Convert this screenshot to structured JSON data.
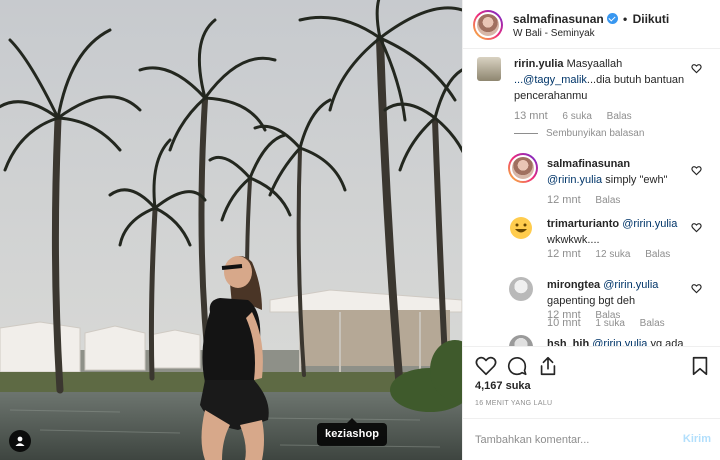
{
  "photo": {
    "tag_label": "keziashop",
    "user_tag_icon": "user-tag-icon"
  },
  "header": {
    "username": "salmafinasunan",
    "separator": "•",
    "follow_status": "Diikuti",
    "location": "W Bali - Seminyak",
    "verified_icon": "verified-badge-icon"
  },
  "comments": [
    {
      "user": "ririn.yulia",
      "text_before": "Masyaallah",
      "mention": "...@tagy_malik",
      "text_after": "...dia butuh bantuan pencerahanmu",
      "time": "13 mnt",
      "likes": "6 suka",
      "reply_label": "Balas"
    }
  ],
  "hide_replies_label": "Sembunyikan balasan",
  "replies": [
    {
      "user": "salmafinasunan",
      "mention": "@ririn.yulia",
      "text": "simply \"ewh\"",
      "time": "12 mnt",
      "likes": "",
      "reply_label": "Balas"
    },
    {
      "user": "trimarturianto",
      "mention": "@ririn.yulia",
      "text": "wkwkwk....",
      "time": "12 mnt",
      "likes": "12 suka",
      "reply_label": "Balas"
    },
    {
      "user": "mirongtea",
      "mention": "@ririn.yulia",
      "text": "gapenting bgt deh",
      "time": "12 mnt",
      "likes": "",
      "reply_label": "Balas"
    },
    {
      "user": "hsh_hih",
      "mention": "@ririn.yulia",
      "text": "yg ada",
      "time": "10 mnt",
      "likes": "1 suka",
      "reply_label": "Balas"
    }
  ],
  "actions": {
    "like_icon": "heart-icon",
    "comment_icon": "comment-icon",
    "share_icon": "share-icon",
    "save_icon": "bookmark-icon"
  },
  "likes_count": "4,167 suka",
  "time_ago": "16 MENIT YANG LALU",
  "comment_input": {
    "placeholder": "Tambahkan komentar...",
    "value": ""
  },
  "post_button_label": "Kirim",
  "colors": {
    "link": "#003569",
    "muted": "#8e8e8e",
    "verified": "#3897f0",
    "post_disabled": "#b2dffc"
  }
}
